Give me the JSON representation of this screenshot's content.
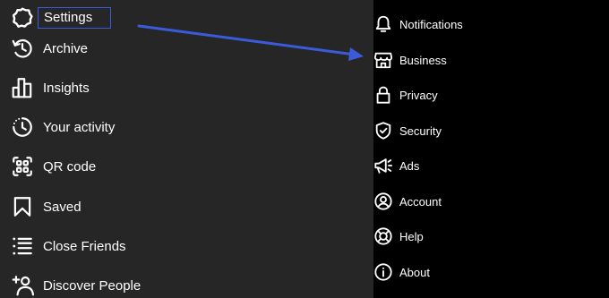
{
  "left_menu": {
    "items": [
      {
        "label": "Settings",
        "icon": "gear-icon"
      },
      {
        "label": "Archive",
        "icon": "archive-icon"
      },
      {
        "label": "Insights",
        "icon": "insights-icon"
      },
      {
        "label": "Your activity",
        "icon": "activity-icon"
      },
      {
        "label": "QR code",
        "icon": "qr-code-icon"
      },
      {
        "label": "Saved",
        "icon": "bookmark-icon"
      },
      {
        "label": "Close Friends",
        "icon": "list-icon"
      },
      {
        "label": "Discover People",
        "icon": "add-person-icon"
      }
    ]
  },
  "settings_menu": {
    "items": [
      {
        "label": "Notifications",
        "icon": "bell-icon"
      },
      {
        "label": "Business",
        "icon": "store-icon"
      },
      {
        "label": "Privacy",
        "icon": "lock-icon"
      },
      {
        "label": "Security",
        "icon": "shield-icon"
      },
      {
        "label": "Ads",
        "icon": "megaphone-icon"
      },
      {
        "label": "Account",
        "icon": "account-icon"
      },
      {
        "label": "Help",
        "icon": "lifebuoy-icon"
      },
      {
        "label": "About",
        "icon": "info-icon"
      }
    ]
  },
  "colors": {
    "left_background": "#262626",
    "right_background": "#000000",
    "highlight": "#3b5bdb",
    "text": "#ffffff"
  }
}
